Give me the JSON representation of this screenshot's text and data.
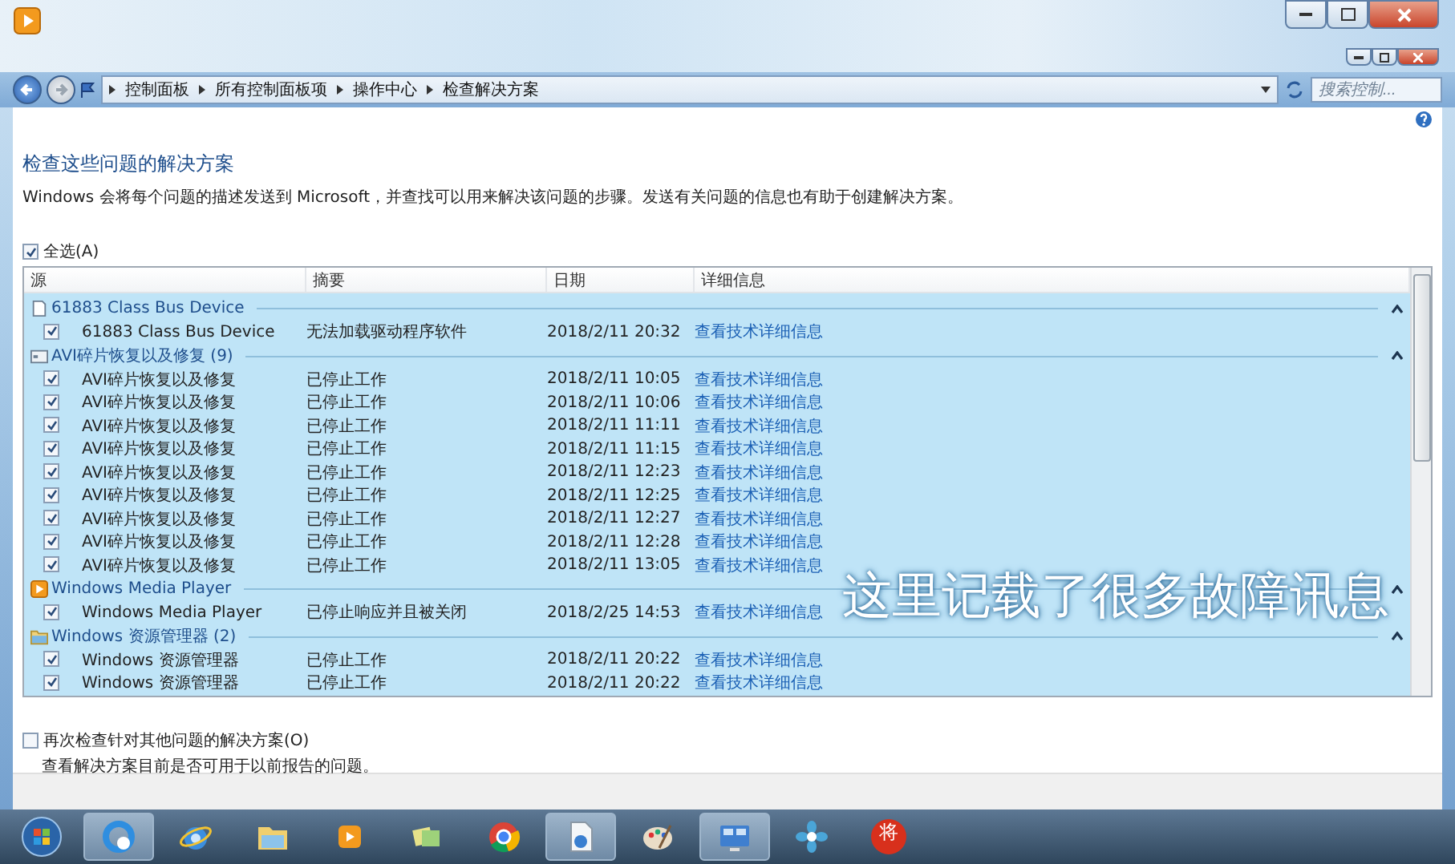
{
  "breadcrumb": [
    "控制面板",
    "所有控制面板项",
    "操作中心",
    "检查解决方案"
  ],
  "search": {
    "placeholder": "搜索控制..."
  },
  "heading": "检查这些问题的解决方案",
  "description": "Windows 会将每个问题的描述发送到 Microsoft，并查找可以用来解决该问题的步骤。发送有关问题的信息也有助于创建解决方案。",
  "select_all": {
    "label": "全选(A)",
    "checked": true
  },
  "table": {
    "columns": [
      "源",
      "摘要",
      "日期",
      "详细信息"
    ],
    "groups": [
      {
        "title": "61883 Class Bus Device",
        "kind": "document",
        "expanded": true,
        "rows": [
          {
            "source": "61883 Class Bus Device",
            "summary": "无法加载驱动程序软件",
            "date": "2018/2/11 20:32",
            "link": "查看技术详细信息",
            "checked": true
          }
        ]
      },
      {
        "title": "AVI碎片恢复以及修复 (9)",
        "kind": "window",
        "expanded": true,
        "rows": [
          {
            "source": "AVI碎片恢复以及修复",
            "summary": "已停止工作",
            "date": "2018/2/11 10:05",
            "link": "查看技术详细信息",
            "checked": true
          },
          {
            "source": "AVI碎片恢复以及修复",
            "summary": "已停止工作",
            "date": "2018/2/11 10:06",
            "link": "查看技术详细信息",
            "checked": true
          },
          {
            "source": "AVI碎片恢复以及修复",
            "summary": "已停止工作",
            "date": "2018/2/11 11:11",
            "link": "查看技术详细信息",
            "checked": true
          },
          {
            "source": "AVI碎片恢复以及修复",
            "summary": "已停止工作",
            "date": "2018/2/11 11:15",
            "link": "查看技术详细信息",
            "checked": true
          },
          {
            "source": "AVI碎片恢复以及修复",
            "summary": "已停止工作",
            "date": "2018/2/11 12:23",
            "link": "查看技术详细信息",
            "checked": true
          },
          {
            "source": "AVI碎片恢复以及修复",
            "summary": "已停止工作",
            "date": "2018/2/11 12:25",
            "link": "查看技术详细信息",
            "checked": true
          },
          {
            "source": "AVI碎片恢复以及修复",
            "summary": "已停止工作",
            "date": "2018/2/11 12:27",
            "link": "查看技术详细信息",
            "checked": true
          },
          {
            "source": "AVI碎片恢复以及修复",
            "summary": "已停止工作",
            "date": "2018/2/11 12:28",
            "link": "查看技术详细信息",
            "checked": true
          },
          {
            "source": "AVI碎片恢复以及修复",
            "summary": "已停止工作",
            "date": "2018/2/11 13:05",
            "link": "查看技术详细信息",
            "checked": true
          }
        ]
      },
      {
        "title": "Windows Media Player",
        "kind": "media",
        "expanded": true,
        "rows": [
          {
            "source": "Windows Media Player",
            "summary": "已停止响应并且被关闭",
            "date": "2018/2/25 14:53",
            "link": "查看技术详细信息",
            "checked": true
          }
        ]
      },
      {
        "title": "Windows 资源管理器 (2)",
        "kind": "folder",
        "expanded": true,
        "rows": [
          {
            "source": "Windows 资源管理器",
            "summary": "已停止工作",
            "date": "2018/2/11 20:22",
            "link": "查看技术详细信息",
            "checked": true
          },
          {
            "source": "Windows 资源管理器",
            "summary": "已停止工作",
            "date": "2018/2/11 20:22",
            "link": "查看技术详细信息",
            "checked": true
          }
        ]
      }
    ]
  },
  "recheck": {
    "label": "再次检查针对其他问题的解决方案(O)",
    "checked": false,
    "description": "查看解决方案目前是否可用于以前报告的问题。"
  },
  "caption": "这里记载了很多故障讯息",
  "taskbar": {
    "items": [
      {
        "kind": "ring",
        "selected": true
      },
      {
        "kind": "browser",
        "selected": false
      },
      {
        "kind": "folder",
        "selected": false
      },
      {
        "kind": "media",
        "selected": false
      },
      {
        "kind": "notes",
        "selected": false
      },
      {
        "kind": "chrome",
        "selected": false
      },
      {
        "kind": "document",
        "selected": true
      },
      {
        "kind": "paint",
        "selected": false
      },
      {
        "kind": "panel",
        "selected": true
      },
      {
        "kind": "flower",
        "selected": false
      },
      {
        "kind": "badge",
        "label": "将",
        "selected": false
      }
    ]
  }
}
